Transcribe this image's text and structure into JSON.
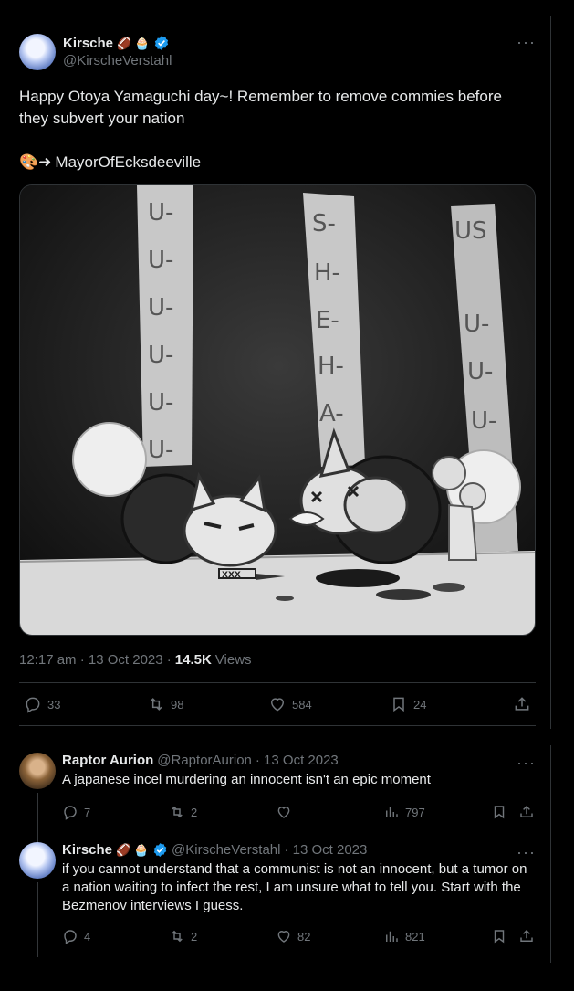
{
  "tweet": {
    "author_name": "Kirsche",
    "author_emojis": "🏈 🧁",
    "author_handle": "@KirscheVerstahl",
    "more": "···",
    "text": "Happy Otoya Yamaguchi day~! Remember to remove commies before they subvert your nation",
    "credit_emoji": "🎨➜",
    "credit_name": "MayorOfEcksdeeville",
    "image": {
      "banner_left": [
        "U-",
        "U-",
        "U-",
        "U-",
        "U-",
        "U-"
      ],
      "banner_middle": [
        "S-",
        "H-",
        "E-",
        "H-",
        "A-"
      ],
      "banner_right": [
        "US",
        "U-",
        "U-",
        "U-"
      ],
      "sword_text": "XXX"
    },
    "time": "12:17 am · 13 Oct 2023 ·",
    "views_count": "14.5K",
    "views_label": "Views",
    "stats": {
      "replies": "33",
      "reposts": "98",
      "likes": "584",
      "bookmarks": "24"
    }
  },
  "replies": [
    {
      "author_name": "Raptor Aurion",
      "author_handle": "@RaptorAurion",
      "date": "· 13 Oct 2023",
      "text": "A japanese incel murdering an innocent isn't an epic moment",
      "more": "···",
      "stats": {
        "replies": "7",
        "reposts": "2",
        "likes": "",
        "views": "797"
      }
    },
    {
      "author_name": "Kirsche",
      "author_emojis": "🏈 🧁",
      "author_handle": "@KirscheVerstahl",
      "date": "· 13 Oct 2023",
      "text": "if you cannot understand that a communist is not an innocent, but a tumor on a nation waiting to infect the rest, I am unsure what to tell you. Start with the Bezmenov interviews I guess.",
      "more": "···",
      "stats": {
        "replies": "4",
        "reposts": "2",
        "likes": "82",
        "views": "821"
      }
    }
  ],
  "colors": {
    "background": "#000000",
    "text": "#e7e9ea",
    "secondary": "#71767b",
    "border": "#2f3336",
    "verified": "#1d9bf0"
  }
}
